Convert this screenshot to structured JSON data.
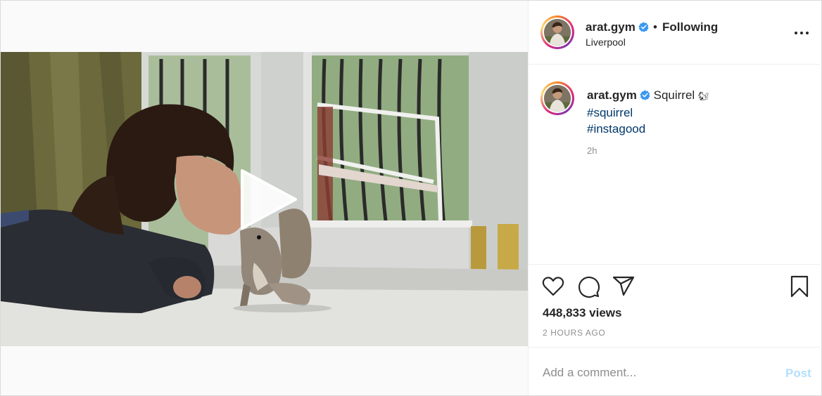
{
  "post": {
    "username": "arat.gym",
    "verified": true,
    "separator": "•",
    "follow_status": "Following",
    "location": "Liverpool",
    "more_icon": "more-horizontal-icon"
  },
  "caption": {
    "username": "arat.gym",
    "text": "Squirrel",
    "emoji": "🐿",
    "hashtags": [
      "#squirrel",
      "#instagood"
    ],
    "relative_time": "2h"
  },
  "media": {
    "type": "video",
    "play_icon": "play-icon"
  },
  "actions": {
    "icons": [
      "heart-icon",
      "comment-icon",
      "share-icon",
      "bookmark-icon"
    ],
    "views": "448,833 views",
    "posted": "2 HOURS AGO"
  },
  "comment": {
    "placeholder": "Add a comment...",
    "post_label": "Post",
    "post_color": "#b2dffc"
  },
  "colors": {
    "hashtag": "#00376b",
    "verified": "#3897f0",
    "muted": "#8e8e8e",
    "text": "#262626"
  }
}
